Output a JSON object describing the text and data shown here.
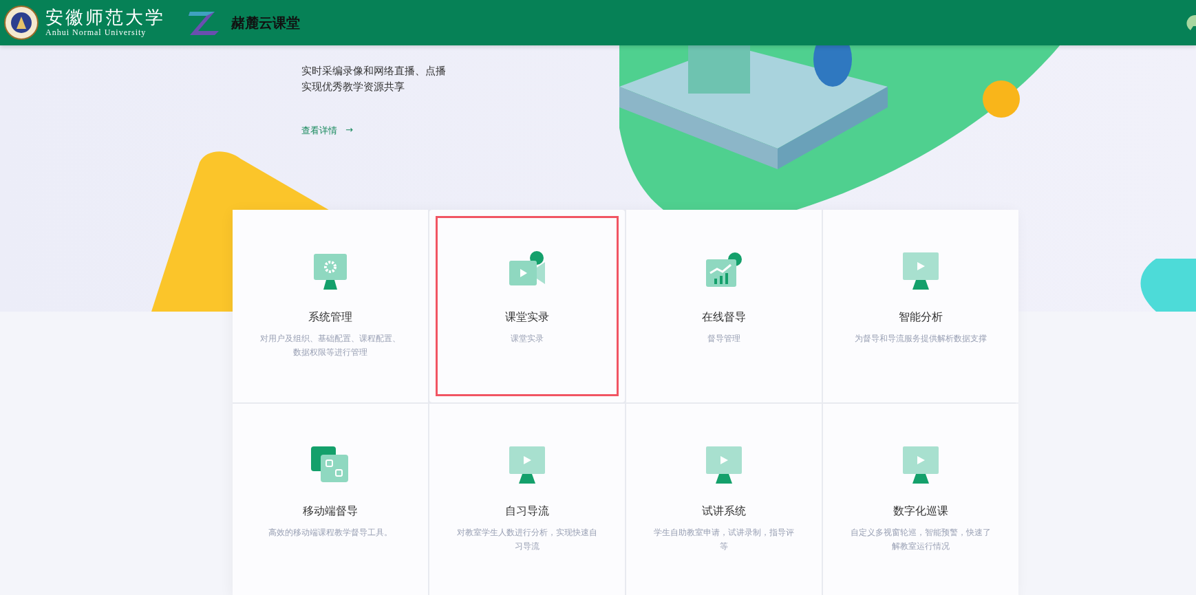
{
  "header": {
    "university_name": "安徽师范大学",
    "university_name_en": "Anhui Normal University",
    "product_name": "赭麓云课堂"
  },
  "hero": {
    "description_lines": [
      "实时采编录像和网络直播、点播",
      "实现优秀教学资源共享"
    ],
    "link": "查看详情",
    "link_arrow": "→"
  },
  "modules": [
    {
      "title": "系统管理",
      "description": "对用户及组织、基础配置、课程配置、数据权限等进行管理",
      "kind": "gear",
      "selected": false
    },
    {
      "title": "课堂实录",
      "description": "课堂实录",
      "kind": "camera",
      "selected": true
    },
    {
      "title": "在线督导",
      "description": "督导管理",
      "kind": "chart",
      "selected": false
    },
    {
      "title": "智能分析",
      "description": "为督导和导流服务提供解析数据支撑",
      "kind": "play",
      "selected": false
    },
    {
      "title": "移动端督导",
      "description": "高效的移动端课程教学督导工具。",
      "kind": "switch",
      "selected": false
    },
    {
      "title": "自习导流",
      "description": "对教室学生人数进行分析，实现快速自习导流",
      "kind": "play",
      "selected": false
    },
    {
      "title": "试讲系统",
      "description": "学生自助教室申请，试讲录制，指导评等",
      "kind": "play",
      "selected": false
    },
    {
      "title": "数字化巡课",
      "description": "自定义多视窗轮巡，智能预警，快速了解教室运行情况",
      "kind": "play",
      "selected": false
    }
  ]
}
